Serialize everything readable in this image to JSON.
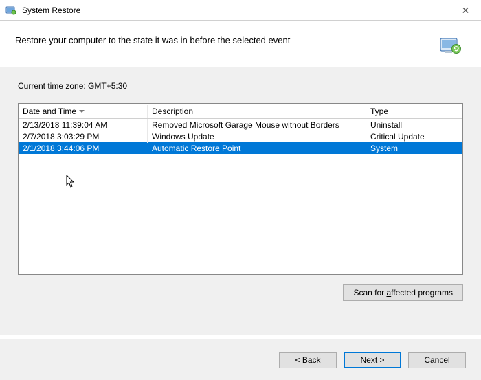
{
  "window": {
    "title": "System Restore",
    "close_label": "✕"
  },
  "header": {
    "heading": "Restore your computer to the state it was in before the selected event"
  },
  "timezone_label": "Current time zone: GMT+5:30",
  "table": {
    "columns": {
      "date": "Date and Time",
      "desc": "Description",
      "type": "Type"
    },
    "rows": [
      {
        "date": "2/13/2018 11:39:04 AM",
        "desc": "Removed Microsoft Garage Mouse without Borders",
        "type": "Uninstall",
        "selected": false
      },
      {
        "date": "2/7/2018 3:03:29 PM",
        "desc": "Windows Update",
        "type": "Critical Update",
        "selected": false
      },
      {
        "date": "2/1/2018 3:44:06 PM",
        "desc": "Automatic Restore Point",
        "type": "System",
        "selected": true
      }
    ]
  },
  "buttons": {
    "scan_pre": "Scan for ",
    "scan_u": "a",
    "scan_post": "ffected programs",
    "back_pre": "< ",
    "back_u": "B",
    "back_post": "ack",
    "next_u": "N",
    "next_post": "ext >",
    "cancel": "Cancel"
  }
}
